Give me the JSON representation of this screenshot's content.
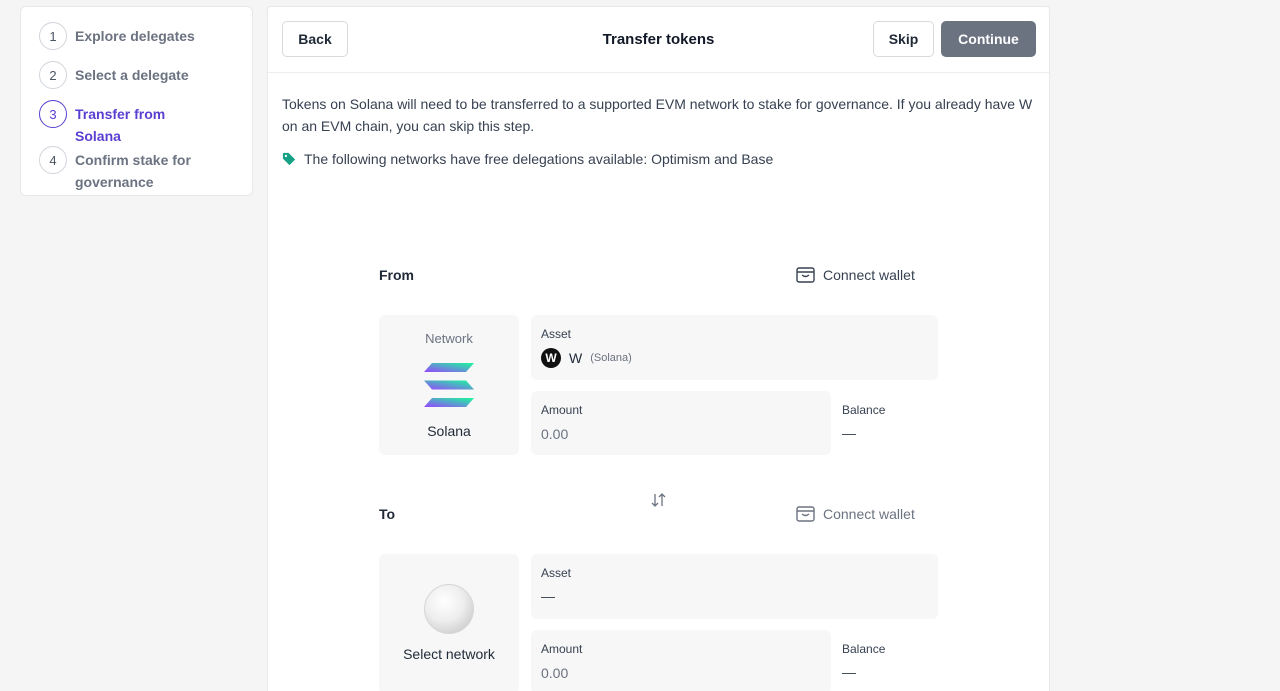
{
  "stepper": {
    "steps": [
      {
        "num": "1",
        "label": "Explore delegates"
      },
      {
        "num": "2",
        "label": "Select a delegate"
      },
      {
        "num": "3",
        "label": "Transfer from Solana"
      },
      {
        "num": "4",
        "label": "Confirm stake for governance"
      }
    ],
    "active_step": 3
  },
  "header": {
    "back_label": "Back",
    "title": "Transfer tokens",
    "skip_label": "Skip",
    "continue_label": "Continue"
  },
  "intro_text": "Tokens on Solana will need to be transferred to a supported EVM network to stake for governance. If you already have W on an EVM chain, you can skip this step.",
  "promo_text": "The following networks have free delegations available: Optimism and Base",
  "from": {
    "label": "From",
    "connect_label": "Connect wallet",
    "network_caption": "Network",
    "network_name": "Solana",
    "asset_label": "Asset",
    "asset_symbol": "W",
    "asset_logo_letter": "W",
    "asset_chain": "(Solana)",
    "amount_label": "Amount",
    "amount_placeholder": "0.00",
    "balance_label": "Balance",
    "balance_value": "—"
  },
  "to": {
    "label": "To",
    "connect_label": "Connect wallet",
    "network_name": "Select network",
    "asset_label": "Asset",
    "asset_value": "—",
    "amount_label": "Amount",
    "amount_placeholder": "0.00",
    "balance_label": "Balance",
    "balance_value": "—"
  },
  "colors": {
    "accent": "#5b3fd1",
    "continue_bg": "#6b7280",
    "tag": "#16a085",
    "panel_bg": "#f7f7f7"
  }
}
